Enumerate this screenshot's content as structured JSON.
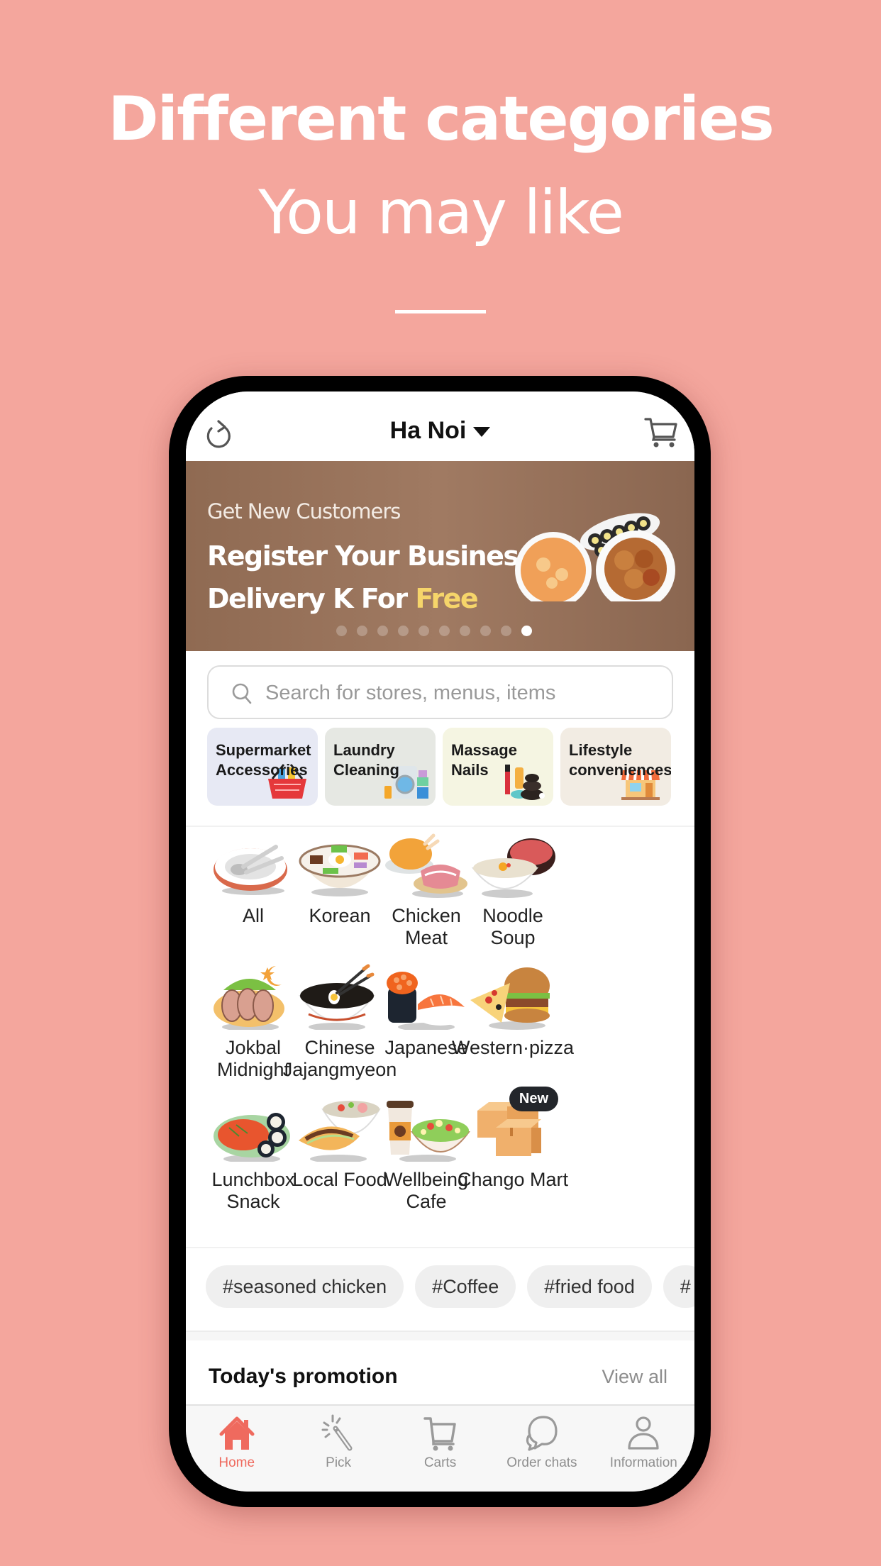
{
  "promo": {
    "headline": "Different categories",
    "subheadline": "You may like"
  },
  "header": {
    "location": "Ha Noi",
    "refresh_icon": "refresh-icon",
    "cart_icon": "cart-icon"
  },
  "banner": {
    "subtitle": "Get New Customers",
    "line1": "Register Your Business",
    "line2_prefix": "Delivery K For ",
    "line2_highlight": "Free",
    "slide_count": 10,
    "active_slide": 10,
    "highlight_color": "#f6d56a"
  },
  "search": {
    "placeholder": "Search for stores, menus, items",
    "value": ""
  },
  "services": [
    {
      "line1": "Supermarket",
      "line2": "Accessories",
      "bg": "#e7e9f4",
      "icon": "shopping-basket-icon"
    },
    {
      "line1": "Laundry",
      "line2": "Cleaning",
      "bg": "#e6e8e3",
      "icon": "washing-machine-icon"
    },
    {
      "line1": "Massage",
      "line2": "Nails",
      "bg": "#f5f5e2",
      "icon": "spa-stones-icon"
    },
    {
      "line1": "Lifestyle",
      "line2": "conveniences",
      "bg": "#f2ece3",
      "icon": "storefront-icon"
    }
  ],
  "categories": [
    {
      "name": "All",
      "icon": "plate-spoon-icon"
    },
    {
      "name": "Korean",
      "icon": "bibimbap-icon"
    },
    {
      "name": "Chicken\nMeat",
      "icon": "chicken-meat-icon"
    },
    {
      "name": "Noodle\nSoup",
      "icon": "noodle-soup-icon"
    },
    {
      "name": "Jokbal\nMidnight",
      "icon": "jokbal-icon"
    },
    {
      "name": "Chinese\nJajangmyeon",
      "icon": "jajangmyeon-icon"
    },
    {
      "name": "Japanese",
      "icon": "sushi-icon"
    },
    {
      "name": "Western·pizza",
      "icon": "pizza-burger-icon"
    },
    {
      "name": "Lunchbox\nSnack",
      "icon": "lunchbox-icon"
    },
    {
      "name": "Local Food",
      "icon": "banh-mi-pho-icon"
    },
    {
      "name": "Wellbeing\nCafe",
      "icon": "coffee-salad-icon"
    },
    {
      "name": "Chango Mart",
      "icon": "boxes-icon",
      "badge": "New"
    }
  ],
  "hashtags": [
    "#seasoned chicken",
    "#Coffee",
    "#fried food",
    "#"
  ],
  "section": {
    "title": "Today's promotion",
    "view_all": "View all"
  },
  "tabbar": {
    "active_color": "#ef6a5e",
    "items": [
      {
        "label": "Home",
        "icon": "home-icon",
        "active": true
      },
      {
        "label": "Pick",
        "icon": "magic-wand-icon",
        "active": false
      },
      {
        "label": "Carts",
        "icon": "cart-icon",
        "active": false
      },
      {
        "label": "Order chats",
        "icon": "chat-bubbles-icon",
        "active": false
      },
      {
        "label": "Information",
        "icon": "user-icon",
        "active": false
      }
    ]
  },
  "colors": {
    "background": "#f4a69d",
    "banner": "#9a745c"
  }
}
